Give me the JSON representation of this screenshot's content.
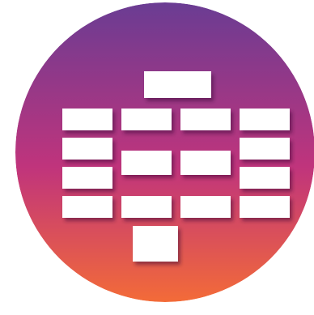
{
  "icon": {
    "name": "hierarchy-grid-app-icon",
    "gradient": {
      "top": "#6a3c93",
      "middle": "#c0347c",
      "bottom": "#f36b38"
    },
    "block_color": "#ffffff",
    "shadow_color": "#2a0b2e"
  }
}
